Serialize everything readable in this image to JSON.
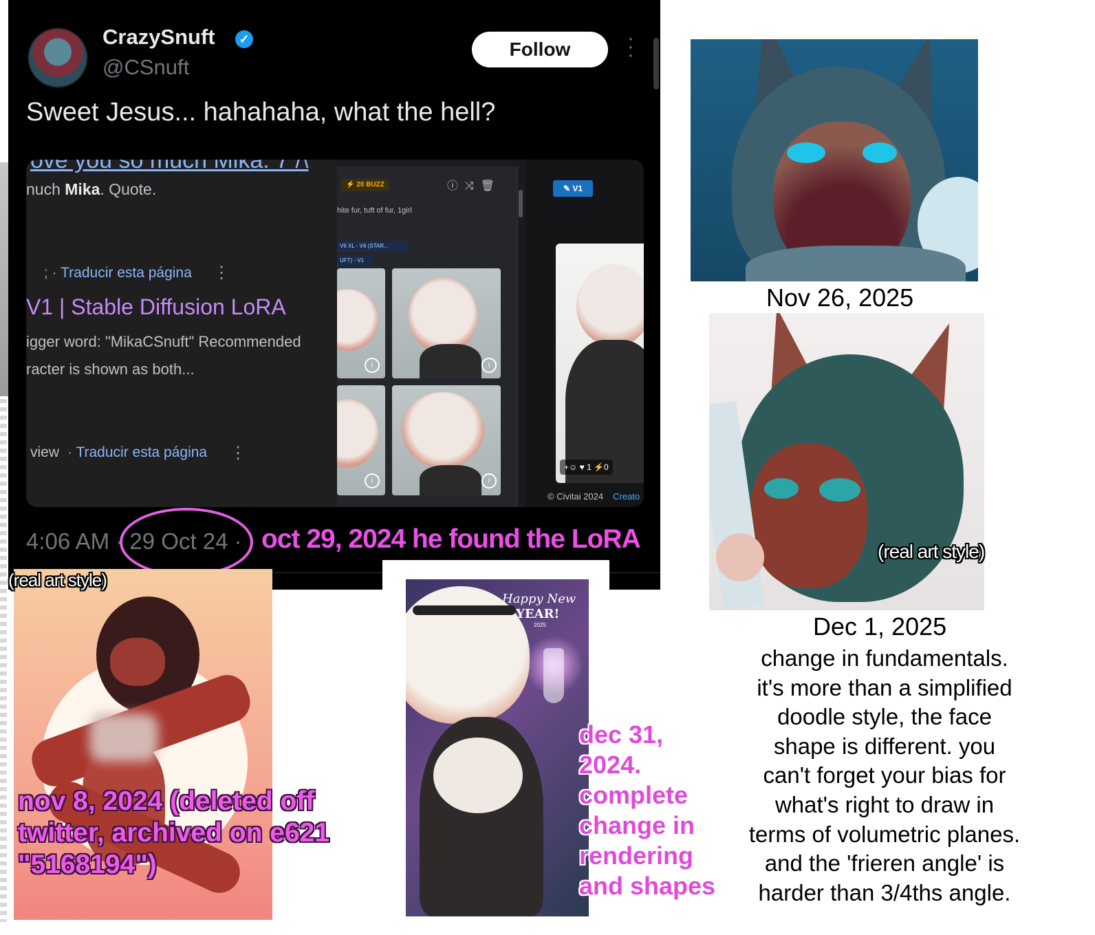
{
  "tweet": {
    "display_name": "CrazySnuft",
    "handle": "@CSnuft",
    "follow_label": "Follow",
    "text": "Sweet Jesus... hahahaha, what the hell?",
    "timestamp": "4:06 AM · 29 Oct 24 ·",
    "embed": {
      "google": {
        "cut_link": "ove you so much Mika. 7 /\\",
        "snippet_plain": "nuch ",
        "snippet_bold": "Mika",
        "snippet_end": ". Quote.",
        "translate_1": "Traducir esta página",
        "result_title": "V1 | Stable Diffusion LoRA",
        "desc_line1": "igger word: \"MikaCSnuft\" Recommended",
        "desc_line2": "racter is shown as both...",
        "view_label": "view",
        "translate_2": "Traducir esta página"
      },
      "civitai": {
        "buzz": "⚡ 20 BUZZ",
        "tags": "hite fur, tuft of fur, 1girl",
        "chip1": "V6 XL - V6 (STAR...",
        "chip2": "UFT) - V1",
        "version_badge": "V1",
        "reaction_count_1": "1",
        "reaction_count_2": "0",
        "footer": "© Civitai 2024",
        "footer_link": "Creato"
      }
    }
  },
  "annotations": {
    "lora_found": "oct 29, 2024 he found the LoRA",
    "nov8_lines": [
      "nov 8, 2024 (deleted off",
      "twitter, archived on e621",
      "\"5168194\")"
    ],
    "dec31_lines": [
      "dec 31,",
      "2024.",
      "complete",
      "change in",
      "rendering",
      "and shapes"
    ],
    "real_style_1": "(real art style)",
    "real_style_2": "(real art style)"
  },
  "captions": {
    "nov26": "Nov 26, 2025",
    "dec1": "Dec 1, 2025"
  },
  "commentary_lines": [
    "change in fundamentals.",
    "it's more than a simplified",
    "doodle style, the face",
    "shape is different. you",
    "can't forget your bias for",
    "what's right to draw in",
    "terms of volumetric planes.",
    "and the 'frieren angle' is",
    "harder than 3/4ths angle."
  ],
  "dec31_art": {
    "greeting_1": "Happy New",
    "greeting_2": "YEAR!",
    "greeting_year": "2025"
  },
  "colors": {
    "annotation_magenta": "#e04ad8",
    "link_blue": "#8ab4f8",
    "result_purple": "#c58af9",
    "verified_blue": "#1d9bf0"
  }
}
